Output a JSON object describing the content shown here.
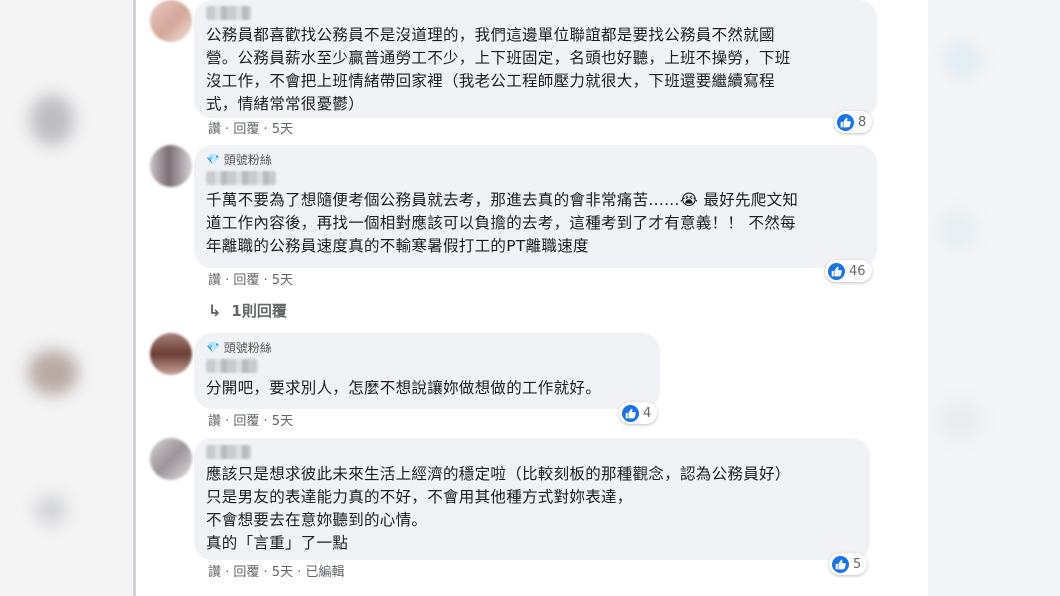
{
  "comments": [
    {
      "badge": "",
      "text": "公務員都喜歡找公務員不是沒道理的，我們這邊單位聯誼都是要找公務員不然就國\n營。公務員薪水至少贏普通勞工不少，上下班固定，名頭也好聽，上班不操勞，下班\n沒工作，不會把上班情緒帶回家裡（我老公工程師壓力就很大，下班還要繼續寫程\n式，情緒常常很憂鬱）",
      "actions": "讚 · 回覆 · 5天",
      "likes": "8"
    },
    {
      "badge": "頭號粉絲",
      "text": "千萬不要為了想隨便考個公務員就去考，那進去真的會非常痛苦......😭 最好先爬文知\n道工作內容後，再找一個相對應該可以負擔的去考，這種考到了才有意義！！ 不然每\n年離職的公務員速度真的不輸寒暑假打工的PT離職速度",
      "actions": "讚 · 回覆 · 5天",
      "likes": "46",
      "replies": "1則回覆"
    },
    {
      "badge": "頭號粉絲",
      "text": "分開吧，要求別人，怎麼不想說讓妳做想做的工作就好。",
      "actions": "讚 · 回覆 · 5天",
      "likes": "4"
    },
    {
      "badge": "",
      "text": "應該只是想求彼此未來生活上經濟的穩定啦（比較刻板的那種觀念，認為公務員好）\n只是男友的表達能力真的不好，不會用其他種方式對妳表達，\n不會想要去在意妳聽到的心情。\n真的「言重」了一點",
      "actions": "讚 · 回覆 · 5天 · 已編輯",
      "likes": "5"
    }
  ],
  "colors": {
    "like_blue": "#1b74e4",
    "bubble_bg": "#f0f2f5",
    "meta_gray": "#65676b"
  }
}
